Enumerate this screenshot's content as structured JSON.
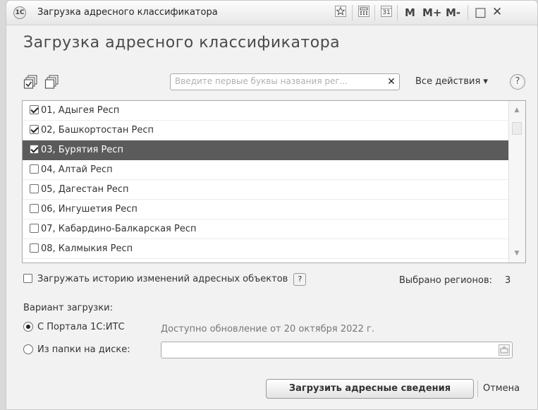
{
  "window": {
    "title": "Загрузка адресного классификатора",
    "app_icon_text": "1С",
    "toolbar": {
      "favorite_icon": "star-icon",
      "calc_icon": "calculator-icon",
      "calendar_icon": "calendar-icon",
      "calendar_label": "31",
      "m": "M",
      "m_plus": "M+",
      "m_minus": "M-",
      "maximize": "□",
      "close": "✕"
    }
  },
  "header": {
    "title": "Загрузка адресного классификатора"
  },
  "toolbar": {
    "search_placeholder": "Введите первые буквы названия рег...",
    "clear_label": "✕",
    "all_actions_label": "Все действия ▾",
    "help_label": "?"
  },
  "regions": [
    {
      "label": "01, Адыгея Респ",
      "checked": true
    },
    {
      "label": "02, Башкортостан Респ",
      "checked": true
    },
    {
      "label": "03, Бурятия Респ",
      "checked": true
    },
    {
      "label": "04, Алтай Респ",
      "checked": false
    },
    {
      "label": "05, Дагестан Респ",
      "checked": false
    },
    {
      "label": "06, Ингушетия Респ",
      "checked": false
    },
    {
      "label": "07, Кабардино-Балкарская Респ",
      "checked": false
    },
    {
      "label": "08, Калмыкия Респ",
      "checked": false
    }
  ],
  "history_option": {
    "label": "Загружать историю изменений адресных объектов",
    "checked": false,
    "help": "?"
  },
  "selected_info": {
    "label": "Выбрано регионов:",
    "count": "3"
  },
  "load_variant": {
    "label": "Вариант загрузки:",
    "portal_label": "С Портала 1С:ИТС",
    "portal_note": "Доступно обновление от 20 октября 2022 г.",
    "folder_label": "Из папки на диске:",
    "folder_value": "",
    "selected": "portal"
  },
  "actions": {
    "load_label": "Загрузить адресные сведения",
    "cancel_label": "Отмена"
  },
  "colors": {
    "window_bg": "#f2f2f2",
    "selected_row": "#5b5b5b",
    "text": "#333333"
  }
}
